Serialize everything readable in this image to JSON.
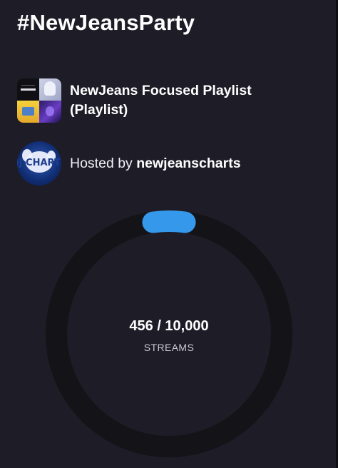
{
  "page": {
    "title": "#NewJeansParty"
  },
  "playlist": {
    "name": "NewJeans Focused Playlist (Playlist)",
    "cover_icon": "playlist-cover-image"
  },
  "host": {
    "prefix": "Hosted by",
    "name": "newjeanscharts",
    "avatar_icon": "newjeanscharts-avatar",
    "avatar_text": "NJ CHARTS"
  },
  "progress": {
    "current": 456,
    "goal": 10000,
    "fraction": 0.0456,
    "label": "456 / 10,000",
    "unit": "STREAMS"
  },
  "colors": {
    "background": "#1d1c27",
    "ring_track": "#141318",
    "ring_fill": "#3598ea",
    "text": "#ffffff"
  }
}
